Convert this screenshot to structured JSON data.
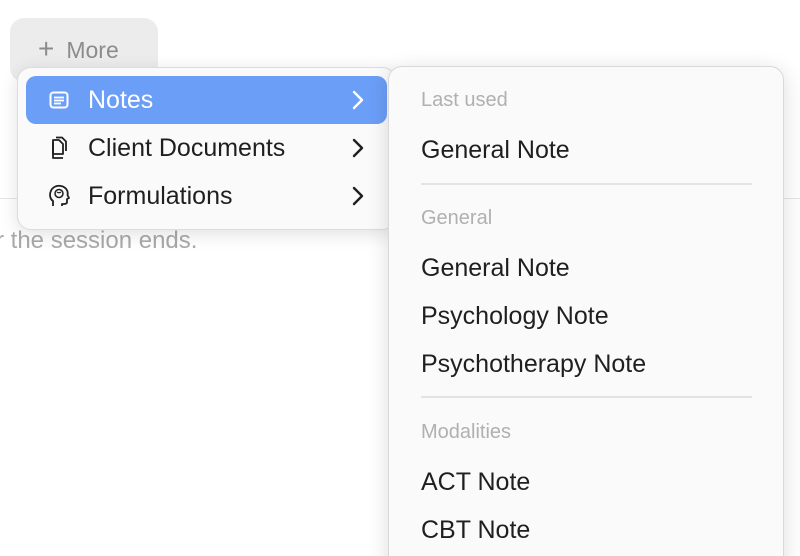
{
  "background": {
    "helper_text": "r the session ends."
  },
  "more_button": {
    "plus": "+",
    "label": "More"
  },
  "menu": {
    "items": [
      {
        "label": "Notes",
        "icon": "note-icon",
        "active": true
      },
      {
        "label": "Client Documents",
        "icon": "documents-icon",
        "active": false
      },
      {
        "label": "Formulations",
        "icon": "head-brain-icon",
        "active": false
      }
    ]
  },
  "submenu": {
    "sections": [
      {
        "header": "Last used",
        "items": [
          "General Note"
        ]
      },
      {
        "header": "General",
        "items": [
          "General Note",
          "Psychology Note",
          "Psychotherapy Note"
        ]
      },
      {
        "header": "Modalities",
        "items": [
          "ACT Note",
          "CBT Note"
        ]
      }
    ]
  },
  "colors": {
    "accent": "#6b9ef7",
    "section_header": "#b0b0b0",
    "menu_bg": "#fafafa"
  }
}
